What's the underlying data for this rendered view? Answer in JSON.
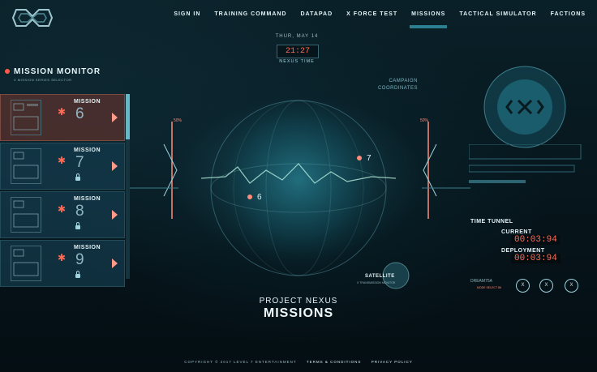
{
  "nav": {
    "items": [
      "SIGN IN",
      "TRAINING COMMAND",
      "DATAPAD",
      "X FORCE TEST",
      "MISSIONS",
      "TACTICAL SIMULATOR",
      "FACTIONS"
    ],
    "active": "MISSIONS"
  },
  "time": {
    "date": "THUR, MAY 14",
    "clock": "21:27",
    "label": "NEXUS TIME"
  },
  "mission_monitor": {
    "title": "MISSION MONITOR",
    "subtitle": "X MISSION SERIES SELECTOR",
    "missions": [
      {
        "label": "MISSION",
        "number": "6",
        "locked": false,
        "selected": true
      },
      {
        "label": "MISSION",
        "number": "7",
        "locked": true,
        "selected": false
      },
      {
        "label": "MISSION",
        "number": "8",
        "locked": true,
        "selected": false
      },
      {
        "label": "MISSION",
        "number": "9",
        "locked": true,
        "selected": false
      }
    ]
  },
  "center": {
    "campaign_line1": "CAMPAIGN",
    "campaign_line2": "COORDINATES",
    "left_pct": "50%",
    "right_pct": "50%",
    "marker_left": "6",
    "marker_right": "7",
    "satellite": "SATELLITE",
    "satellite_sub": "X TRANSMISSION MONITOR",
    "project": "PROJECT NEXUS",
    "title": "MISSIONS"
  },
  "right": {
    "time_tunnel": "TIME TUNNEL",
    "current_label": "CURRENT",
    "current_value": "00:03:94",
    "deployment_label": "DEPLOYMENT",
    "deployment_value": "00:03:94",
    "dream_label": "DREAM75A",
    "dream_sub": "MODE SELECT 86",
    "buttons": [
      "X",
      "X",
      "X"
    ]
  },
  "footer": {
    "copyright": "COPYRIGHT © 2017 LEVEL 7 ENTERTAINMENT",
    "terms": "TERMS & CONDITIONS",
    "privacy": "PRIVACY POLICY"
  },
  "colors": {
    "accent": "#ff6b57",
    "teal": "#62b9c7",
    "panel": "#143c4e"
  }
}
